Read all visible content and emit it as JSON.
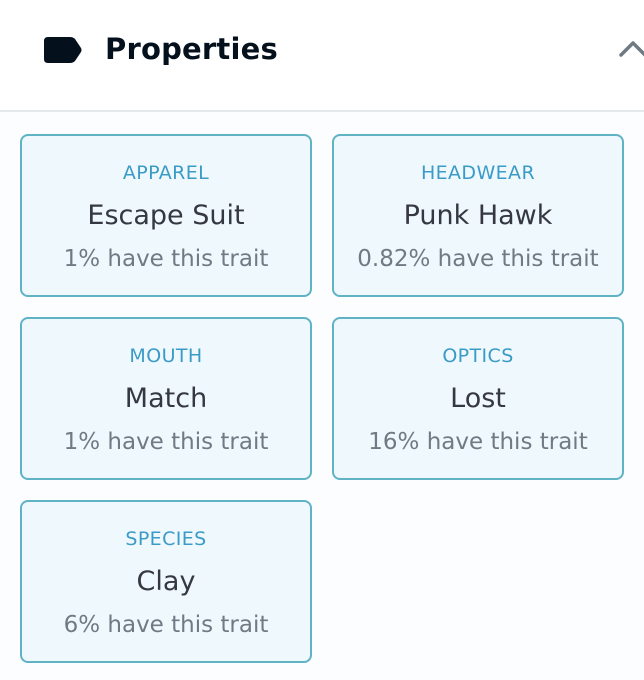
{
  "header": {
    "icon": "tag-icon",
    "title": "Properties",
    "toggle_icon": "chevron-up-icon"
  },
  "colors": {
    "card_border": "#5fb3c5",
    "card_background": "#eff8fd",
    "trait_type": "#3a9bc7",
    "trait_value": "#353840",
    "rarity_text": "#707a83"
  },
  "properties": [
    {
      "type": "APPAREL",
      "value": "Escape Suit",
      "rarity": "1% have this trait"
    },
    {
      "type": "HEADWEAR",
      "value": "Punk Hawk",
      "rarity": "0.82% have this trait"
    },
    {
      "type": "MOUTH",
      "value": "Match",
      "rarity": "1% have this trait"
    },
    {
      "type": "OPTICS",
      "value": "Lost",
      "rarity": "16% have this trait"
    },
    {
      "type": "SPECIES",
      "value": "Clay",
      "rarity": "6% have this trait"
    }
  ]
}
